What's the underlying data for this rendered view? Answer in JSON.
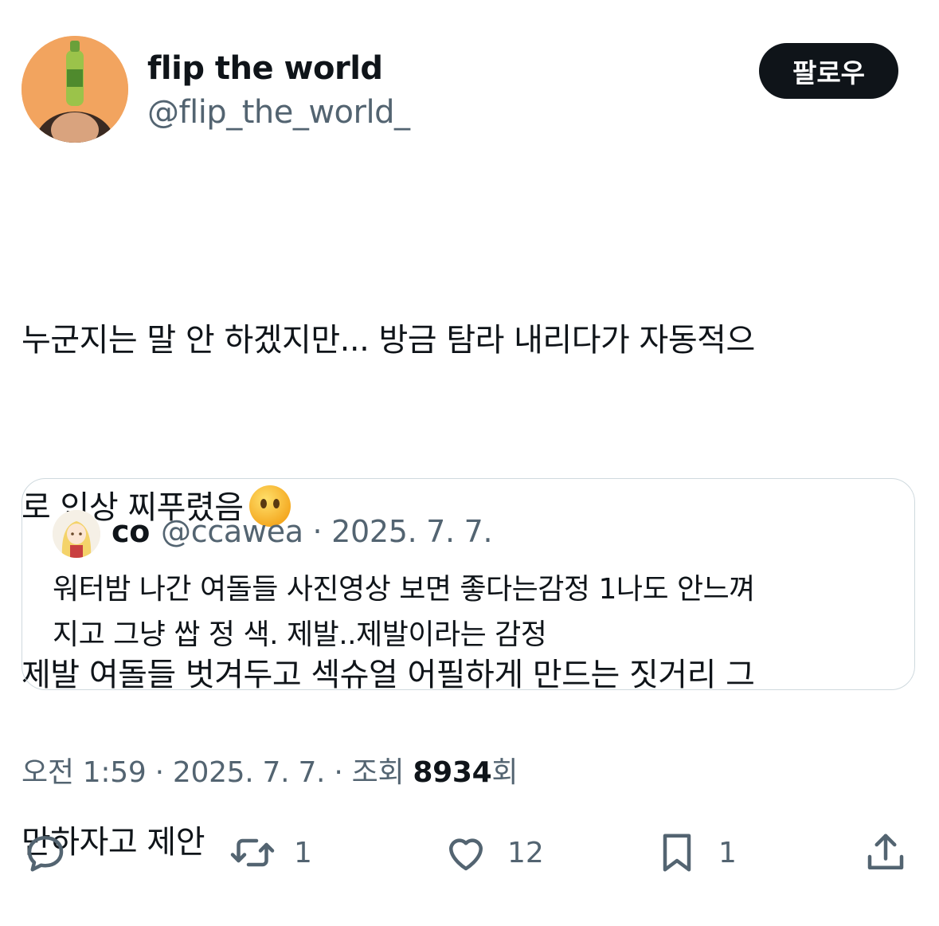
{
  "author": {
    "name": "flip the world",
    "handle": "@flip_the_world_",
    "follow_label": "팔로우"
  },
  "tweet": {
    "lines": [
      "누군지는 말 안 하겠지만... 방금 탐라 내리다가 자동적으",
      "로 인상 찌푸렸음",
      "제발 여돌들 벗겨두고 섹슈얼 어필하게 만드는 짓거리 그",
      "만하자고 제안"
    ],
    "emoji": "no-mouth-face-emoji"
  },
  "quote": {
    "name": "co",
    "meta": "@ccawea · 2025. 7. 7.",
    "lines": [
      "워터밤 나간 여돌들 사진영상 보면 좋다는감정 1나도 안느껴",
      "지고 그냥 쌉 정 색. 제발..제발이라는 감정"
    ]
  },
  "meta": {
    "time_date": "오전 1:59 · 2025. 7. 7. · 조회 ",
    "views": "8934",
    "views_suffix": "회"
  },
  "actions": {
    "reply_icon": "reply-icon",
    "retweet_count": "1",
    "like_count": "12",
    "bookmark_count": "1",
    "share_icon": "share-icon"
  },
  "colors": {
    "text": "#0f1419",
    "secondary": "#536471",
    "border": "#cfd9de",
    "button_bg": "#0f1419"
  }
}
